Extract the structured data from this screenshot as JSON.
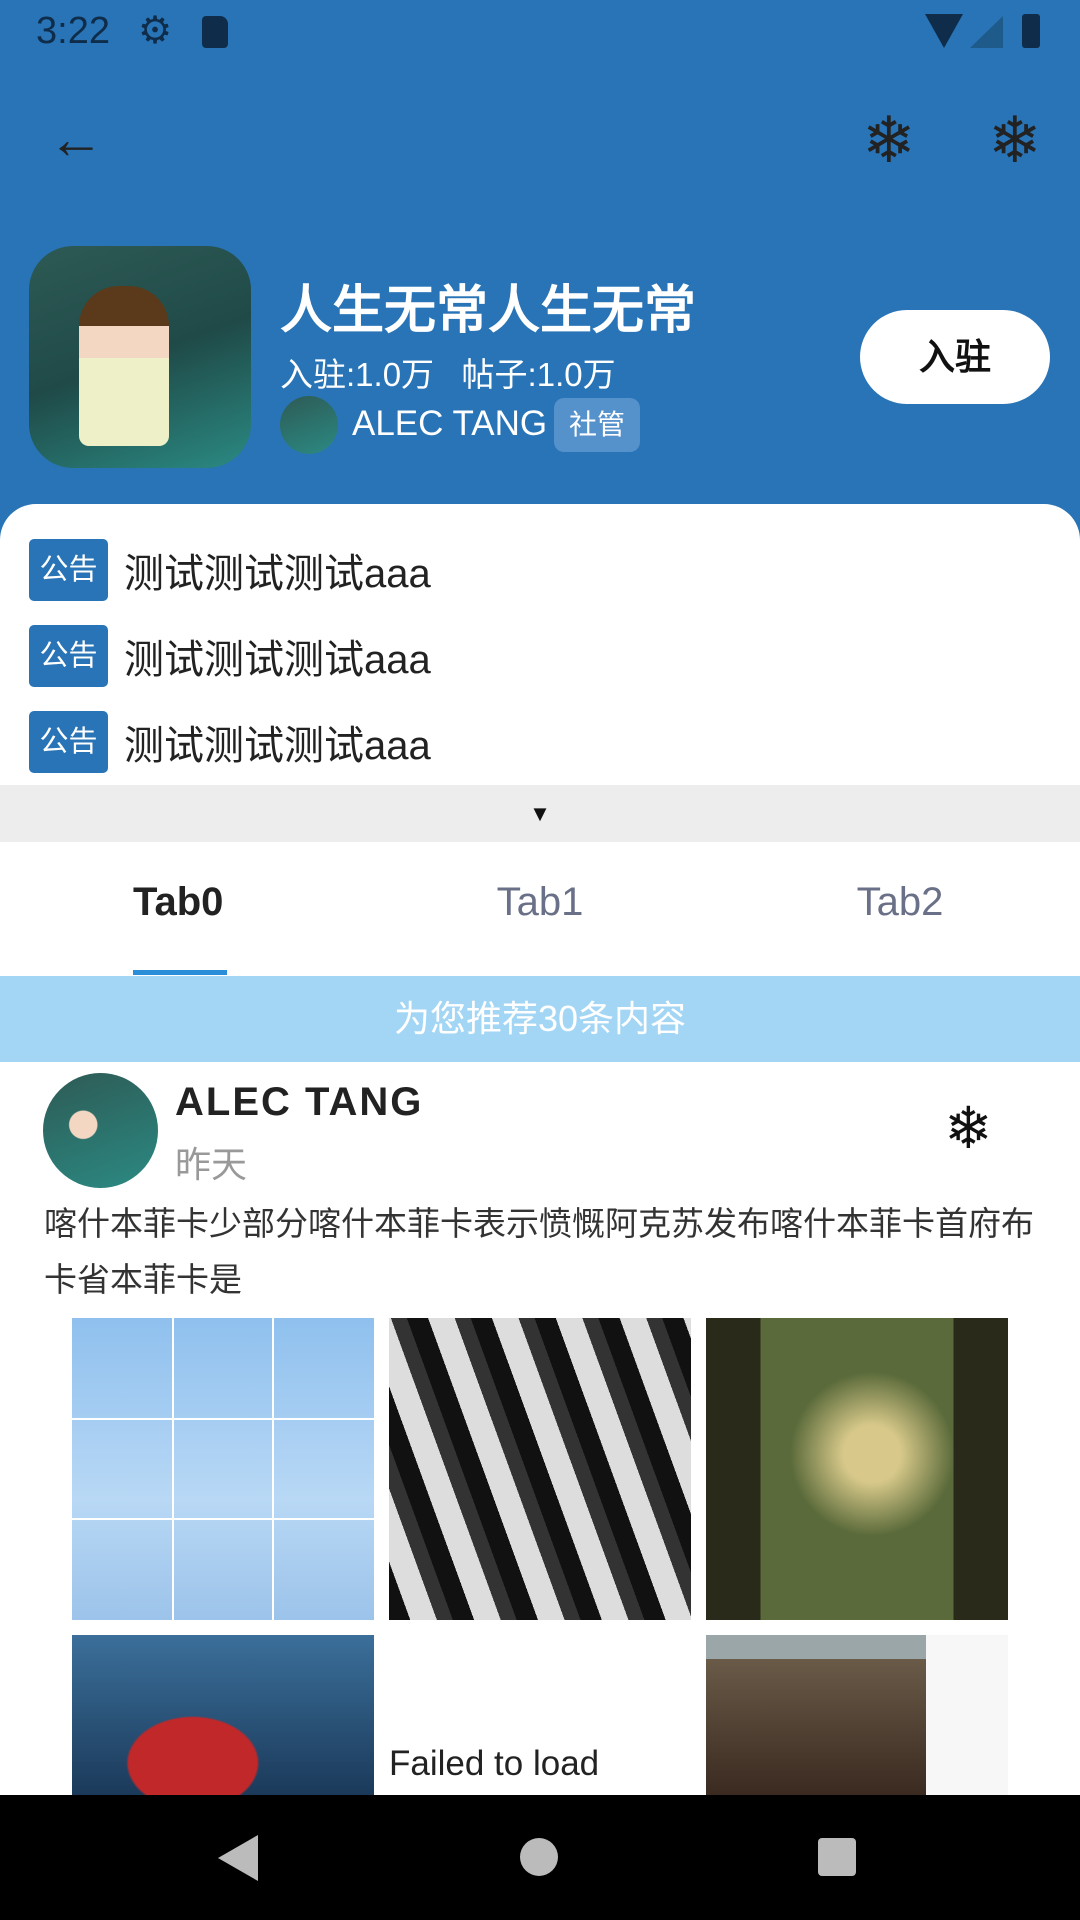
{
  "status_bar": {
    "time": "3:22"
  },
  "header": {
    "title": "人生无常人生无常",
    "stats": "入驻:1.0万   帖子:1.0万",
    "owner": "ALEC TANG",
    "owner_tag": "社管",
    "join_label": "入驻"
  },
  "notices": [
    {
      "badge": "公告",
      "text": "测试测试测试aaa"
    },
    {
      "badge": "公告",
      "text": "测试测试测试aaa"
    },
    {
      "badge": "公告",
      "text": "测试测试测试aaa"
    }
  ],
  "tabs": [
    {
      "label": "Tab0"
    },
    {
      "label": "Tab1"
    },
    {
      "label": "Tab2"
    }
  ],
  "banner": "为您推荐30条内容",
  "post": {
    "author": "ALEC TANG",
    "time": "昨天",
    "text": "喀什本菲卡少部分喀什本菲卡表示愤慨阿克苏发布喀什本菲卡首府布卡省本菲卡是",
    "failed_label": "Failed to load"
  }
}
